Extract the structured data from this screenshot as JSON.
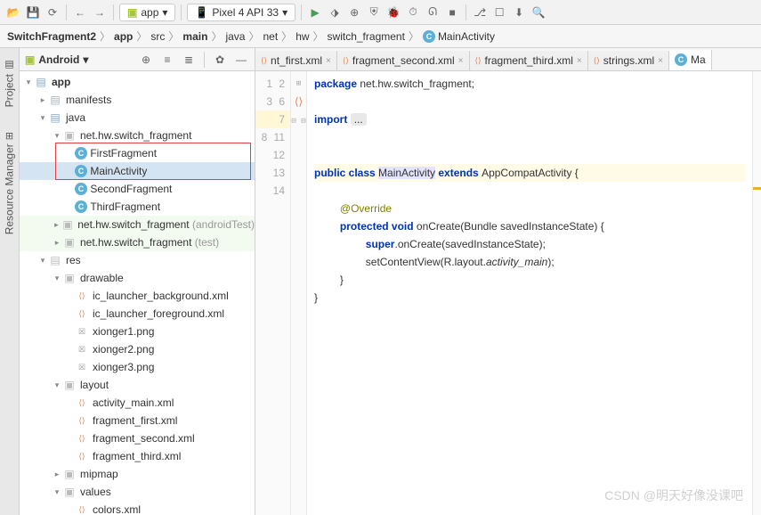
{
  "toolbar": {
    "module": "app",
    "device": "Pixel 4 API 33"
  },
  "breadcrumb": {
    "items": [
      "SwitchFragment2",
      "app",
      "src",
      "main",
      "java",
      "net",
      "hw",
      "switch_fragment"
    ],
    "current": "MainActivity"
  },
  "sideTabs": {
    "project": "Project",
    "resMgr": "Resource Manager"
  },
  "panel": {
    "title": "Android"
  },
  "tree": {
    "app": "app",
    "manifests": "manifests",
    "java": "java",
    "pkg1": "net.hw.switch_fragment",
    "files": {
      "first": "FirstFragment",
      "main": "MainActivity",
      "second": "SecondFragment",
      "third": "ThirdFragment"
    },
    "pkg2": "net.hw.switch_fragment",
    "pkg2suffix": "(androidTest)",
    "pkg3": "net.hw.switch_fragment",
    "pkg3suffix": "(test)",
    "res": "res",
    "drawable": "drawable",
    "drawFiles": [
      "ic_launcher_background.xml",
      "ic_launcher_foreground.xml",
      "xionger1.png",
      "xionger2.png",
      "xionger3.png"
    ],
    "layout": "layout",
    "layoutFiles": [
      "activity_main.xml",
      "fragment_first.xml",
      "fragment_second.xml",
      "fragment_third.xml"
    ],
    "mipmap": "mipmap",
    "values": "values",
    "valFiles": [
      "colors.xml"
    ]
  },
  "editorTabs": {
    "t1": "nt_first.xml",
    "t2": "fragment_second.xml",
    "t3": "fragment_third.xml",
    "t4": "strings.xml",
    "t5": "Ma"
  },
  "code": {
    "lines": [
      "1",
      "2",
      "3",
      "",
      "6",
      "7",
      "8",
      "",
      "",
      "11",
      "12",
      "13",
      "14"
    ],
    "l1a": "package",
    "l1b": " net.hw.switch_fragment;",
    "l3a": "import",
    "l3b": " ",
    "l7a": "public class ",
    "l7b": "MainActivity",
    "l7c": " extends ",
    "l7d": "AppCompatActivity {",
    "l9a": "@Override",
    "l10a": "protected void ",
    "l10b": "onCreate",
    "l10c": "(Bundle savedInstanceState) {",
    "l11a": "super",
    "l11b": ".onCreate(savedInstanceState);",
    "l12a": "setContentView(R.layout.",
    "l12b": "activity_main",
    "l12c": ");",
    "l13": "}",
    "l14": "}"
  },
  "watermark": "CSDN @明天好像没课吧"
}
